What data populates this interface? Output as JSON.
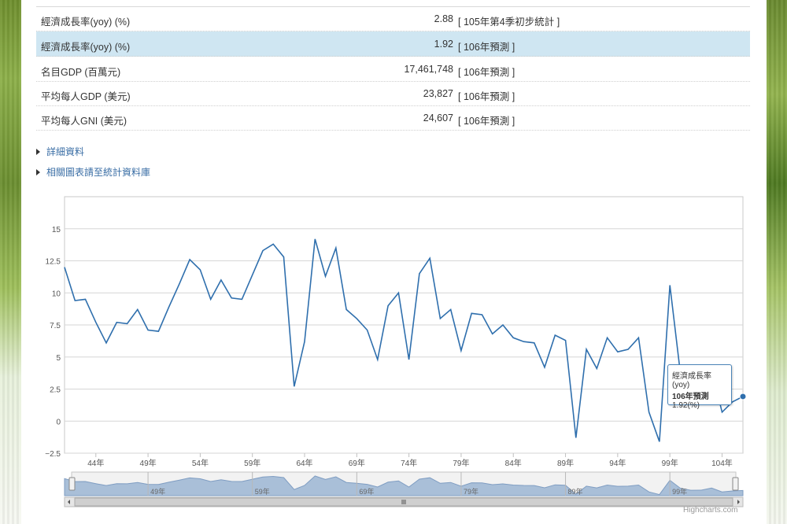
{
  "table": {
    "rows": [
      {
        "label": "經濟成長率(yoy) (%)",
        "value": "2.88",
        "note": "[ 105年第4季初步統計 ]"
      },
      {
        "label": "經濟成長率(yoy) (%)",
        "value": "1.92",
        "note": "[ 106年預測 ]"
      },
      {
        "label": "名目GDP (百萬元)",
        "value": "17,461,748",
        "note": "[ 106年預測 ]"
      },
      {
        "label": "平均每人GDP (美元)",
        "value": "23,827",
        "note": "[ 106年預測 ]"
      },
      {
        "label": "平均每人GNI (美元)",
        "value": "24,607",
        "note": "[ 106年預測 ]"
      }
    ]
  },
  "links": {
    "detail": "詳細資料",
    "more": "相關圖表請至統計資料庫"
  },
  "tooltip": {
    "series": "經濟成長率(yoy)",
    "point": "106年預測",
    "value": "1.92(%)"
  },
  "credit": "Highcharts.com",
  "colors": {
    "line": "#2f6fad",
    "navigator_fill": "#a9bfd8",
    "highlight_row": "#cfe6f2"
  },
  "chart_data": {
    "type": "line",
    "title": "",
    "xlabel": "",
    "ylabel": "",
    "ylim": [
      -2.5,
      17.5
    ],
    "yticks": [
      "−2.5",
      "0",
      "2.5",
      "5",
      "7.5",
      "10",
      "12.5",
      "15"
    ],
    "ytick_values": [
      -2.5,
      0,
      2.5,
      5,
      7.5,
      10,
      12.5,
      15
    ],
    "xticks": [
      "44年",
      "49年",
      "54年",
      "59年",
      "64年",
      "69年",
      "74年",
      "79年",
      "84年",
      "89年",
      "94年",
      "99年",
      "104年"
    ],
    "xtick_years": [
      44,
      49,
      54,
      59,
      64,
      69,
      74,
      79,
      84,
      89,
      94,
      99,
      104
    ],
    "navigator_ticks": [
      "49年",
      "59年",
      "69年",
      "79年",
      "89年",
      "99年"
    ],
    "navigator_tick_years": [
      49,
      59,
      69,
      79,
      89,
      99
    ],
    "grid": true,
    "series": [
      {
        "name": "經濟成長率(yoy)",
        "x": [
          41,
          42,
          43,
          44,
          45,
          46,
          47,
          48,
          49,
          50,
          51,
          52,
          53,
          54,
          55,
          56,
          57,
          58,
          59,
          60,
          61,
          62,
          63,
          64,
          65,
          66,
          67,
          68,
          69,
          70,
          71,
          72,
          73,
          74,
          75,
          76,
          77,
          78,
          79,
          80,
          81,
          82,
          83,
          84,
          85,
          86,
          87,
          88,
          89,
          90,
          91,
          92,
          93,
          94,
          95,
          96,
          97,
          98,
          99,
          100,
          101,
          102,
          103,
          104,
          105,
          106
        ],
        "values": [
          12.0,
          9.4,
          9.5,
          7.7,
          6.1,
          7.7,
          7.6,
          8.7,
          7.1,
          7.0,
          8.9,
          10.7,
          12.6,
          11.8,
          9.5,
          11.0,
          9.6,
          9.5,
          11.4,
          13.3,
          13.8,
          12.8,
          2.7,
          6.2,
          14.2,
          11.3,
          13.5,
          8.7,
          8.0,
          7.1,
          4.8,
          9.0,
          10.0,
          4.8,
          11.5,
          12.7,
          8.0,
          8.7,
          5.5,
          8.4,
          8.3,
          6.8,
          7.5,
          6.5,
          6.2,
          6.1,
          4.2,
          6.7,
          6.3,
          -1.3,
          5.6,
          4.1,
          6.5,
          5.4,
          5.6,
          6.5,
          0.7,
          -1.6,
          10.6,
          3.8,
          2.1,
          2.2,
          4.0,
          0.7,
          1.5,
          1.92
        ]
      }
    ]
  }
}
